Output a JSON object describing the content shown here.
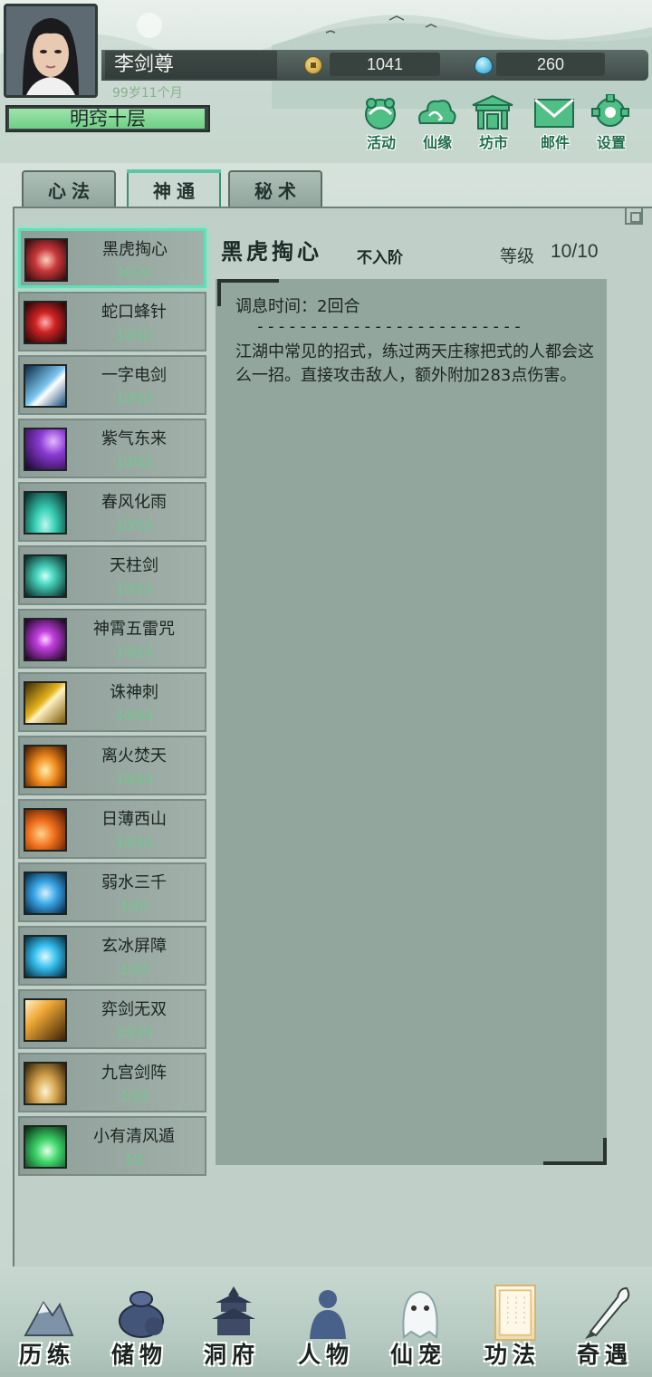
{
  "player": {
    "name": "李剑尊",
    "age": "99岁11个月",
    "realm": "明窍十层",
    "coins": "1041",
    "gems": "260"
  },
  "top_menu": [
    {
      "label": "活动",
      "icon": "activity-icon"
    },
    {
      "label": "仙缘",
      "icon": "cloud-icon"
    },
    {
      "label": "坊市",
      "icon": "market-icon"
    },
    {
      "label": "邮件",
      "icon": "mail-icon"
    },
    {
      "label": "设置",
      "icon": "gear-icon"
    }
  ],
  "tabs": [
    {
      "label": "心法",
      "active": false
    },
    {
      "label": "神通",
      "active": true
    },
    {
      "label": "秘术",
      "active": false
    }
  ],
  "skills": [
    {
      "name": "黑虎掏心",
      "level": "10/10",
      "icon": "black-tiger-icon",
      "color": "#c9373a"
    },
    {
      "name": "蛇口蜂针",
      "level": "10/10",
      "icon": "snake-needle-icon",
      "color": "#d12323"
    },
    {
      "name": "一字电剑",
      "level": "10/10",
      "icon": "lightning-sword-icon",
      "color": "#7cc6ef"
    },
    {
      "name": "紫气东来",
      "level": "10/10",
      "icon": "purple-qi-icon",
      "color": "#8a3ad3"
    },
    {
      "name": "春风化雨",
      "level": "10/10",
      "icon": "spring-rain-icon",
      "color": "#39d1b8"
    },
    {
      "name": "天柱剑",
      "level": "10/10",
      "icon": "sky-pillar-sword-icon",
      "color": "#4ad8c2"
    },
    {
      "name": "神霄五雷咒",
      "level": "10/10",
      "icon": "five-thunder-icon",
      "color": "#c43fe0"
    },
    {
      "name": "诛神刺",
      "level": "10/10",
      "icon": "god-slaying-spear-icon",
      "color": "#e5b41e"
    },
    {
      "name": "离火焚天",
      "level": "10/10",
      "icon": "fire-icon",
      "color": "#f08a1c"
    },
    {
      "name": "日薄西山",
      "level": "10/10",
      "icon": "sunset-icon",
      "color": "#ef6d1a"
    },
    {
      "name": "弱水三千",
      "level": "1/10",
      "icon": "water-icon",
      "color": "#3aa6e8"
    },
    {
      "name": "玄冰屏障",
      "level": "1/10",
      "icon": "ice-barrier-icon",
      "color": "#36c0ef"
    },
    {
      "name": "弈剑无双",
      "level": "10/10",
      "icon": "sword-slash-icon",
      "color": "#efa836"
    },
    {
      "name": "九宫剑阵",
      "level": "1/10",
      "icon": "sword-array-icon",
      "color": "#d3a24a"
    },
    {
      "name": "小有清风遁",
      "level": "1/1",
      "icon": "wind-escape-icon",
      "color": "#3ed66a"
    }
  ],
  "detail": {
    "title": "黑虎掏心",
    "tier": "不入阶",
    "level_label": "等级",
    "level_value": "10/10",
    "cooldown": "调息时间：2回合",
    "divider": "-------------------------",
    "description": "江湖中常见的招式，练过两天庄稼把式的人都会这么一招。直接攻击敌人，额外附加283点伤害。"
  },
  "bottom_nav": [
    {
      "label": "历练",
      "icon": "mountain-icon",
      "active": false
    },
    {
      "label": "储物",
      "icon": "bag-icon",
      "active": false
    },
    {
      "label": "洞府",
      "icon": "pagoda-icon",
      "active": false
    },
    {
      "label": "人物",
      "icon": "person-icon",
      "active": false
    },
    {
      "label": "仙宠",
      "icon": "ghost-pet-icon",
      "active": false
    },
    {
      "label": "功法",
      "icon": "scroll-icon",
      "active": true
    },
    {
      "label": "奇遇",
      "icon": "brush-icon",
      "active": false
    }
  ]
}
